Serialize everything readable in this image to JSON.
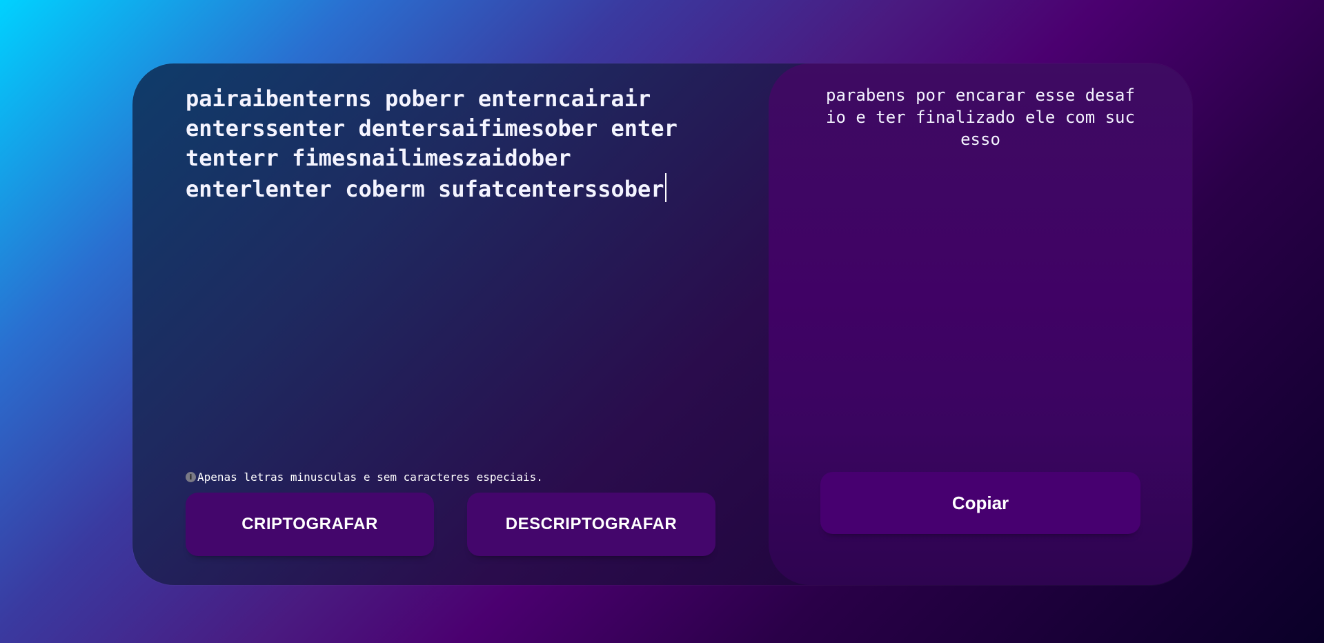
{
  "input": {
    "text": "pairaibenterns poberr enterncairair enterssenter dentersaifimesober enter tenterr fimesnailimeszaidober enterlenter coberm sufatcenterssober"
  },
  "hint": {
    "icon": "info-icon",
    "icon_glyph": "i",
    "text": "Apenas letras minusculas e sem caracteres especiais."
  },
  "buttons": {
    "encrypt_label": "CRIPTOGRAFAR",
    "decrypt_label": "DESCRIPTOGRAFAR"
  },
  "output": {
    "text": "parabens por encarar esse desafio e ter finalizado ele com sucesso",
    "copy_label": "Copiar"
  },
  "colors": {
    "button_bg": "#44066c",
    "output_panel_bg": "#400265",
    "text": "#f4f4ff"
  }
}
